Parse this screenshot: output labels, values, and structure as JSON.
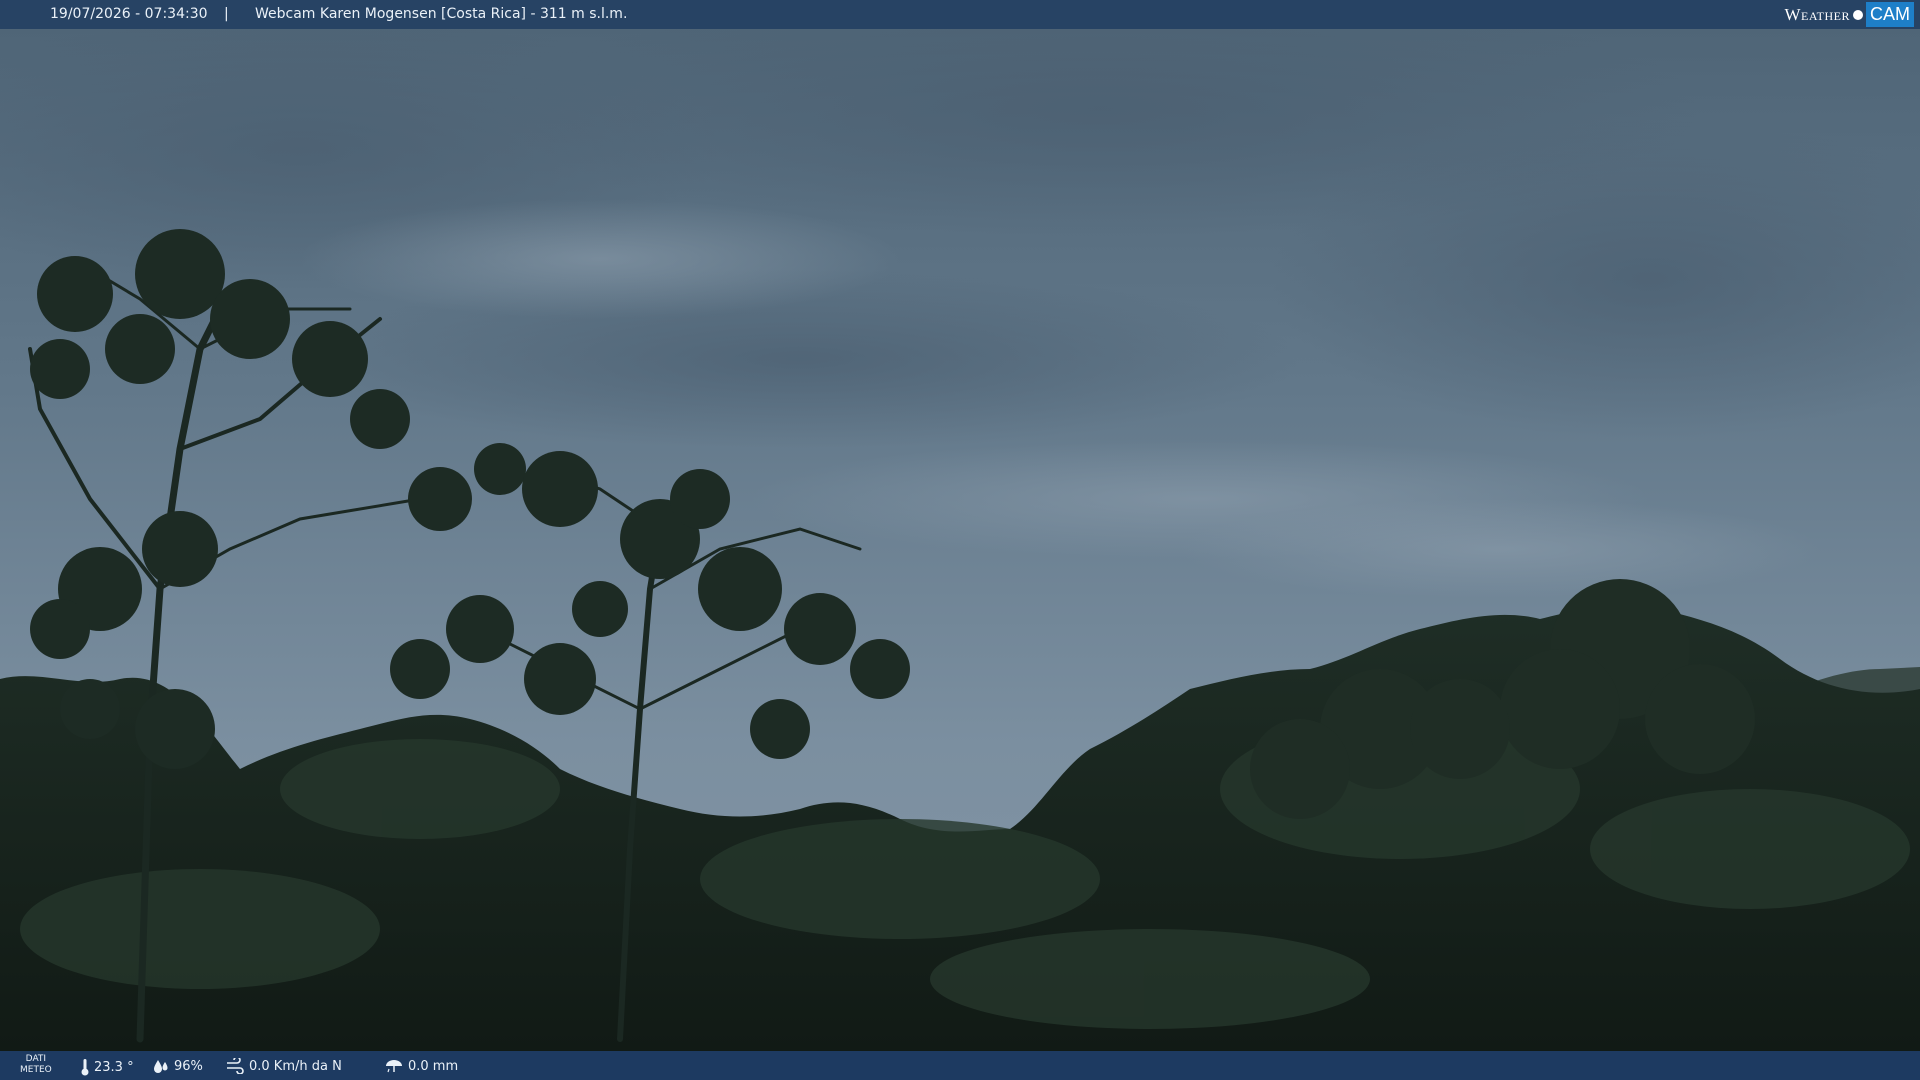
{
  "header": {
    "datetime": "19/07/2026 - 07:34:30",
    "separator": "|",
    "title": "Webcam Karen Mogensen [Costa Rica]  - 311 m s.l.m.",
    "logo_weather": "Weather",
    "logo_cam": "CAM"
  },
  "footer": {
    "label_line1": "DATI",
    "label_line2": "METEO",
    "temperature": "23.3 °",
    "humidity": "96%",
    "wind": "0.0 Km/h da N",
    "rain": "0.0 mm"
  },
  "icons": {
    "temperature": "thermometer-icon",
    "humidity": "droplets-icon",
    "wind": "wind-icon",
    "rain": "rain-icon"
  },
  "colors": {
    "bar": "#284669",
    "logo_accent": "#1e7fc8",
    "sky": "#6e8496",
    "forest": "#18251d"
  }
}
